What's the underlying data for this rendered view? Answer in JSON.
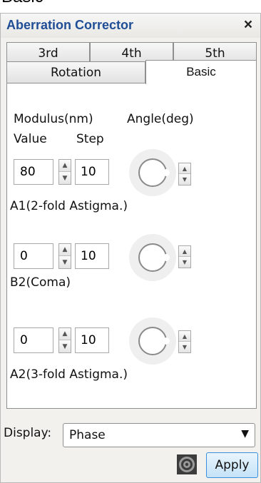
{
  "top_cut_text": "Basic",
  "window": {
    "title": "Aberration Corrector",
    "close_label": "×"
  },
  "tabs": {
    "row1": [
      "3rd",
      "4th",
      "5th"
    ],
    "row2": [
      "Rotation",
      "Basic"
    ],
    "active": "Basic"
  },
  "headers": {
    "modulus": "Modulus(nm)",
    "angle": "Angle(deg)",
    "value": "Value",
    "step": "Step"
  },
  "aberrations": [
    {
      "value": "80",
      "step": "10",
      "label": "A1(2-fold Astigma.)"
    },
    {
      "value": "0",
      "step": "10",
      "label": "B2(Coma)"
    },
    {
      "value": "0",
      "step": "10",
      "label": "A2(3-fold Astigma.)"
    }
  ],
  "display": {
    "label": "Display:",
    "selected": "Phase"
  },
  "buttons": {
    "apply": "Apply"
  },
  "colors": {
    "title": "#1f4e96",
    "apply_border": "#3a8fdc"
  },
  "icons": {
    "spin_up": "▲",
    "spin_down": "▼",
    "dropdown": "▼"
  }
}
